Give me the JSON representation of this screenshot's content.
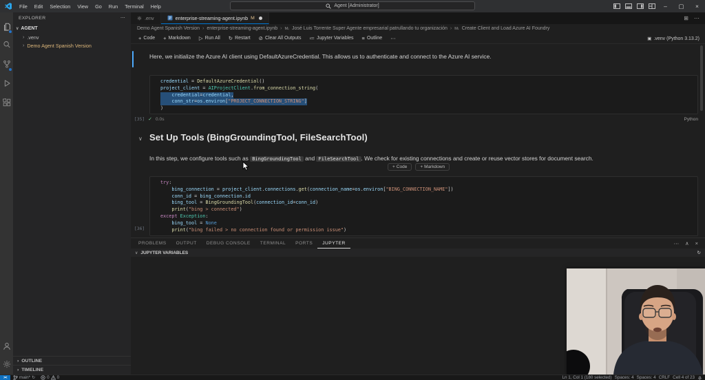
{
  "colors": {
    "accent": "#0078d4",
    "selection_blue": "#264f78",
    "git_modified": "#e2c08d"
  },
  "icons": {
    "plus": "+",
    "chevron_right": "›",
    "chevron_down": "∨",
    "chevron_up": "∧",
    "run": "▷",
    "restart": "↻",
    "clear": "⊘",
    "variables": "≔",
    "outline": "≡",
    "ellipsis": "⋯",
    "kernel": "▣",
    "split_editor": "⊞",
    "close": "×",
    "minimize": "–",
    "maximize": "▢",
    "check": "✓",
    "markdown_cell": "M↓",
    "remote": "><",
    "sync": "↻"
  },
  "titlebar": {
    "menus": [
      "File",
      "Edit",
      "Selection",
      "View",
      "Go",
      "Run",
      "Terminal",
      "Help"
    ],
    "search_label": "Agent [Administrator]"
  },
  "sidebar": {
    "header": "EXPLORER",
    "workspace": "AGENT",
    "items": [
      ".venv",
      "Demo Agent Spanish Version"
    ],
    "outline_label": "OUTLINE",
    "timeline_label": "TIMELINE"
  },
  "editor": {
    "tabs": [
      {
        "label": ".env"
      },
      {
        "label": "enterprise-streaming-agent.ipynb",
        "git_status": "M"
      }
    ],
    "breadcrumbs": [
      "Demo Agent Spanish Version",
      "enterprise-streaming-agent.ipynb",
      "José Luis Torrente Super Agente empresarial patrullando tu organización",
      "Create Client and Load Azure AI Foundry"
    ],
    "toolbar": {
      "code": "Code",
      "markdown": "Markdown",
      "run_all": "Run All",
      "restart": "Restart",
      "clear": "Clear All Outputs",
      "variables": "Jupyter Variables",
      "outline": "Outline",
      "kernel": ".venv (Python 3.13.2)"
    }
  },
  "notebook": {
    "md1": "Here, we initialize the Azure AI client using DefaultAzureCredential. This allows us to authenticate and connect to the Azure AI service.",
    "cell1_exec": "[35]",
    "cell1_time": "0.0s",
    "cell1_lang": "Python",
    "heading": "Set Up Tools (BingGroundingTool, FileSearchTool)",
    "md2": {
      "before": "In this step, we configure tools such as ",
      "code1": "BingGroundingTool",
      "mid": " and ",
      "code2": "FileSearchTool",
      "after": ". We check for existing connections and create or reuse vector stores for document search."
    },
    "insert_code": "Code",
    "insert_markdown": "Markdown",
    "cell2_exec": "[36]",
    "code_cells": [
      {
        "lines": [
          {
            "tokens": [
              [
                "v",
                "credential"
              ],
              [
                "o",
                " = "
              ],
              [
                "f",
                "DefaultAzureCredential"
              ],
              [
                "o",
                "()"
              ]
            ]
          },
          {
            "tokens": [
              [
                "v",
                "project_client"
              ],
              [
                "o",
                " = "
              ],
              [
                "c",
                "AIProjectClient"
              ],
              [
                "o",
                "."
              ],
              [
                "f",
                "from_connection_string"
              ],
              [
                "o",
                "("
              ]
            ]
          },
          {
            "tokens": [
              [
                "o",
                "    "
              ],
              [
                "v",
                "credential"
              ],
              [
                "o",
                "="
              ],
              [
                "v",
                "credential"
              ],
              [
                "o",
                ","
              ]
            ],
            "selected": true
          },
          {
            "tokens": [
              [
                "o",
                "    "
              ],
              [
                "v",
                "conn_str"
              ],
              [
                "o",
                "="
              ],
              [
                "v",
                "os"
              ],
              [
                "o",
                "."
              ],
              [
                "v",
                "environ"
              ],
              [
                "o",
                "["
              ],
              [
                "s",
                "\"PROJECT_CONNECTION_STRING\""
              ],
              [
                "o",
                "]"
              ]
            ],
            "selected": true
          },
          {
            "tokens": [
              [
                "o",
                ")"
              ]
            ]
          }
        ]
      },
      {
        "lines": [
          {
            "tokens": [
              [
                "k",
                "try"
              ],
              [
                "o",
                ":"
              ]
            ]
          },
          {
            "tokens": [
              [
                "o",
                "    "
              ],
              [
                "v",
                "bing_connection"
              ],
              [
                "o",
                " = "
              ],
              [
                "v",
                "project_client"
              ],
              [
                "o",
                "."
              ],
              [
                "v",
                "connections"
              ],
              [
                "o",
                "."
              ],
              [
                "f",
                "get"
              ],
              [
                "o",
                "("
              ],
              [
                "v",
                "connection_name"
              ],
              [
                "o",
                "="
              ],
              [
                "v",
                "os"
              ],
              [
                "o",
                "."
              ],
              [
                "v",
                "environ"
              ],
              [
                "o",
                "["
              ],
              [
                "s",
                "\"BING_CONNECTION_NAME\""
              ],
              [
                "o",
                "])"
              ]
            ]
          },
          {
            "tokens": [
              [
                "o",
                "    "
              ],
              [
                "v",
                "conn_id"
              ],
              [
                "o",
                " = "
              ],
              [
                "v",
                "bing_connection"
              ],
              [
                "o",
                "."
              ],
              [
                "v",
                "id"
              ]
            ]
          },
          {
            "tokens": [
              [
                "o",
                "    "
              ],
              [
                "v",
                "bing_tool"
              ],
              [
                "o",
                " = "
              ],
              [
                "f",
                "BingGroundingTool"
              ],
              [
                "o",
                "("
              ],
              [
                "v",
                "connection_id"
              ],
              [
                "o",
                "="
              ],
              [
                "v",
                "conn_id"
              ],
              [
                "o",
                ")"
              ]
            ]
          },
          {
            "tokens": [
              [
                "o",
                "    "
              ],
              [
                "f",
                "print"
              ],
              [
                "o",
                "("
              ],
              [
                "s",
                "\"bing > connected\""
              ],
              [
                "o",
                ")"
              ]
            ]
          },
          {
            "tokens": [
              [
                "k",
                "except"
              ],
              [
                "o",
                " "
              ],
              [
                "c",
                "Exception"
              ],
              [
                "o",
                ":"
              ]
            ]
          },
          {
            "tokens": [
              [
                "o",
                "    "
              ],
              [
                "v",
                "bing_tool"
              ],
              [
                "o",
                " = "
              ],
              [
                "b",
                "None"
              ]
            ]
          },
          {
            "tokens": [
              [
                "o",
                "    "
              ],
              [
                "f",
                "print"
              ],
              [
                "o",
                "("
              ],
              [
                "s",
                "\"bing failed > no connection found or permission issue\""
              ],
              [
                "o",
                ")"
              ]
            ]
          }
        ]
      }
    ]
  },
  "code_palette": {
    "v": "#9CDCFE",
    "o": "#D4D4D4",
    "f": "#DCDCAA",
    "c": "#4EC9B0",
    "k": "#C586C0",
    "b": "#569CD6",
    "s": "#CE9178"
  },
  "panel": {
    "tabs": [
      "PROBLEMS",
      "OUTPUT",
      "DEBUG CONSOLE",
      "TERMINAL",
      "PORTS",
      "JUPYTER"
    ],
    "section": "JUPYTER VARIABLES"
  },
  "statusbar": {
    "branch": "main*",
    "errors": "0",
    "warnings": "0",
    "cursor": "Ln 1, Col 1 (180 selected)",
    "indent": "Spaces: 4",
    "indent2": "Spaces: 4",
    "eol": "CRLF",
    "cell": "Cell 4 of 23"
  }
}
